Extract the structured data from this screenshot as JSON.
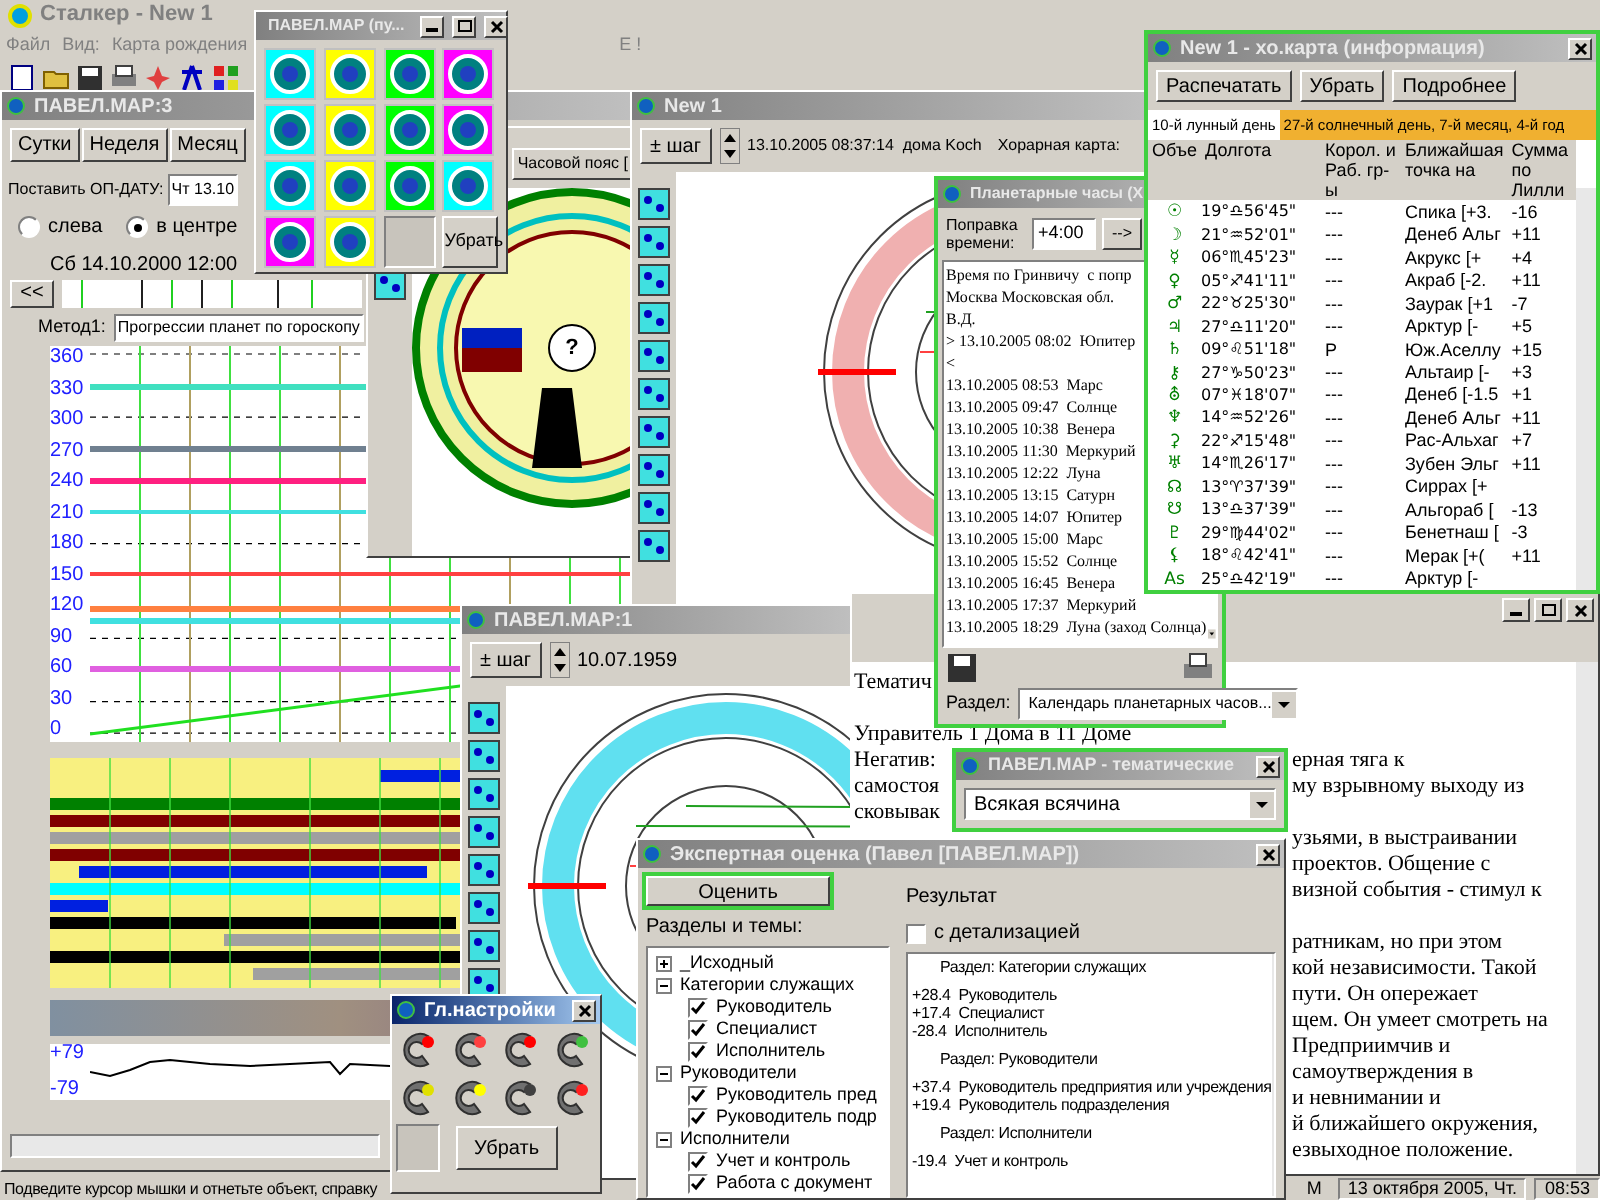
{
  "app": {
    "title": "Сталкер - New 1",
    "menu": [
      "Файл",
      "Вид:",
      "Карта рождения",
      "E !"
    ]
  },
  "tool_palette": {
    "title": "ПАВЕЛ.MAP (пу...",
    "button": "Убрать"
  },
  "schedule_window": {
    "title": "ПАВЕЛ.MAP:3",
    "tabs": [
      {
        "label": "Сутки",
        "selected": false
      },
      {
        "label": "Неделя",
        "selected": false
      },
      {
        "label": "Месяц",
        "selected": false
      }
    ],
    "date_label": "Поставить ОП-ДАТУ:",
    "date_value": "Чт 13.10",
    "align": [
      {
        "label": "слева",
        "selected": false
      },
      {
        "label": "в центре",
        "selected": true
      }
    ],
    "current": "Сб 14.10.2000 12:00",
    "back_button": "<<",
    "method_label": "Метод1:",
    "method_value": "Прогрессии планет по гороскопу",
    "y_labels": [
      "360",
      "330",
      "300",
      "270",
      "240",
      "210",
      "180",
      "150",
      "120",
      "90",
      "60",
      "30",
      "0"
    ],
    "index_labels": [
      "+79",
      "-79"
    ]
  },
  "wheel_window": {
    "timezone_button": "Часовой пояс [",
    "center": "?"
  },
  "horary_window": {
    "title": "New 1",
    "step_button": "± шаг",
    "datetime": "13.10.2005 08:37:14  дома Koch",
    "chart_label": "Хорарная карта:"
  },
  "hours_window": {
    "title": "Планетарные часы (Х",
    "correction_label": "Поправка времени:",
    "correction_value": "+4:00",
    "go_button": "-->",
    "lines": [
      "Время по Гринвичу  с попр",
      "Москва Московская обл.",
      "В.Д.",
      "> 13.10.2005 08:02  Юпитер",
      "<",
      "13.10.2005 08:53  Марс",
      "13.10.2005 09:47  Солнце",
      "13.10.2005 10:38  Венера",
      "13.10.2005 11:30  Меркурий",
      "13.10.2005 12:22  Луна",
      "13.10.2005 13:15  Сатурн",
      "13.10.2005 14:07  Юпитер",
      "13.10.2005 15:00  Марс",
      "13.10.2005 15:52  Солнце",
      "13.10.2005 16:45  Венера",
      "13.10.2005 17:37  Меркурий",
      "13.10.2005 18:29  Луна (заход Солнца)"
    ],
    "section_label": "Раздел:",
    "section_value": "Календарь планетарных часов..."
  },
  "info_window": {
    "title": "New 1 - хо.карта (информация)",
    "buttons": [
      "Распечатать",
      "Убрать",
      "Подробнее"
    ],
    "tabs": [
      {
        "label": "10-й лунный день",
        "selected": true
      },
      {
        "label": "27-й солнечный день, 7-й месяц, 4-й год",
        "selected": false
      }
    ],
    "columns": [
      "Объе",
      "Долгота",
      "Корол. и Раб. гр-ы",
      "Ближайшая точка на",
      "Сумма по Лилли"
    ],
    "rows": [
      {
        "object": "☉",
        "longitude": "19°♎56'45\"",
        "group": "---",
        "point": "Спика [+3.",
        "sum": "-16"
      },
      {
        "object": "☽",
        "longitude": "21°♒52'01\"",
        "group": "---",
        "point": "Денеб Альг",
        "sum": "+11"
      },
      {
        "object": "☿",
        "longitude": "06°♏45'23\"",
        "group": "---",
        "point": "Акрукс [+",
        "sum": "+4"
      },
      {
        "object": "♀",
        "longitude": "05°♐41'11\"",
        "group": "---",
        "point": "Акраб [-2.",
        "sum": "+11"
      },
      {
        "object": "♂",
        "longitude": "22°♉25'30\"",
        "group": "---",
        "point": "Заурак [+1",
        "sum": "-7"
      },
      {
        "object": "♃",
        "longitude": "27°♎11'20\"",
        "group": "---",
        "point": "Арктур [-",
        "sum": "+5"
      },
      {
        "object": "♄",
        "longitude": "09°♌51'18\"",
        "group": "Р",
        "point": "Юж.Аселлу",
        "sum": "+15"
      },
      {
        "object": "⚷",
        "longitude": "27°♑50'23\"",
        "group": "---",
        "point": "Альтаир [-",
        "sum": "+3"
      },
      {
        "object": "⛢",
        "longitude": "07°♓18'07\"",
        "group": "---",
        "point": "Денеб [-1.5",
        "sum": "+1"
      },
      {
        "object": "♆",
        "longitude": "14°♒52'26\"",
        "group": "---",
        "point": "Денеб Альг",
        "sum": "+11"
      },
      {
        "object": "⚳",
        "longitude": "22°♐15'48\"",
        "group": "---",
        "point": "Рас-Альхаг",
        "sum": "+7"
      },
      {
        "object": "♅",
        "longitude": "14°♏26'17\"",
        "group": "---",
        "point": "Зубен Эльг",
        "sum": "+11"
      },
      {
        "object": "☊",
        "longitude": "13°♈37'39\"",
        "group": "---",
        "point": "Сиррах [+"
      },
      {
        "object": "☋",
        "longitude": "13°♎37'39\"",
        "group": "---",
        "point": "Альгораб [",
        "sum": "-13"
      },
      {
        "object": "♇",
        "longitude": "29°♍44'02\"",
        "group": "---",
        "point": "Бенетнаш [",
        "sum": "-3"
      },
      {
        "object": "⚸",
        "longitude": "18°♌42'41\"",
        "group": "---",
        "point": "Мерак [+(",
        "sum": "+11"
      },
      {
        "object": "As",
        "longitude": "25°♎42'19\"",
        "group": "---",
        "point": "Арктур [-"
      }
    ]
  },
  "natal_window": {
    "title": "ПАВЕЛ.MAP:1",
    "step_button": "± шаг",
    "date": "10.07.1959"
  },
  "text_window": {
    "paragraphs": [
      [
        {
          "left": "Тематич"
        }
      ],
      [
        {
          "left": "Управитель 1 Дома в 11 Доме"
        },
        {
          "left": "Негатив:",
          "right": "ерная тяга к"
        },
        {
          "left": "самостоя",
          "right": "му взрывному выходу из"
        },
        {
          "left": "сковывак"
        },
        {
          "right": "узьями, в выстраивании"
        },
        {
          "right": "проектов. Общение с"
        },
        {
          "right": "визной события - стимул к"
        }
      ],
      [
        {
          "right": "ратникам, но при этом"
        },
        {
          "right": "кой независимости. Такой"
        },
        {
          "right": "пути. Он опережает"
        },
        {
          "right": "щем. Он умеет смотреть на"
        },
        {
          "right": "Предприимчив и"
        },
        {
          "right": "самоутверждения в"
        },
        {
          "right": "и невнимании и"
        },
        {
          "right": "й ближайшего окружения,"
        },
        {
          "right": "езвыходное положение."
        }
      ]
    ]
  },
  "themes_window": {
    "title": "ПАВЕЛ.MAP - тематические",
    "value": "Всякая всячина"
  },
  "expert_window": {
    "title": "Экспертная оценка (Павел [ПАВЕЛ.MAP])",
    "evaluate_button": "Оценить",
    "sections_label": "Разделы и темы:",
    "result_label": "Результат",
    "detail": {
      "label": "с детализацией",
      "checked": false
    },
    "tree": [
      {
        "label": "_Исходный",
        "expanded": false
      },
      {
        "label": "Категории служащих",
        "expanded": true,
        "children": [
          {
            "label": "Руководитель",
            "checked": true
          },
          {
            "label": "Специалист",
            "checked": true
          },
          {
            "label": "Исполнитель",
            "checked": true
          }
        ]
      },
      {
        "label": "Руководители",
        "expanded": true,
        "children": [
          {
            "label": "Руководитель пред",
            "checked": true
          },
          {
            "label": "Руководитель подр",
            "checked": true
          }
        ]
      },
      {
        "label": "Исполнители",
        "expanded": true,
        "children": [
          {
            "label": "Учет и контроль",
            "checked": true
          },
          {
            "label": "Работа с документ",
            "checked": true
          }
        ]
      }
    ],
    "results": [
      {
        "kind": "heading",
        "text": "Раздел: Категории служащих"
      },
      {
        "kind": "score",
        "text": "+28.4  Руководитель"
      },
      {
        "kind": "score",
        "text": "+17.4  Специалист"
      },
      {
        "kind": "score",
        "text": "-28.4  Исполнитель"
      },
      {
        "kind": "heading",
        "text": "Раздел: Руководители"
      },
      {
        "kind": "score",
        "text": "+37.4  Руководитель предприятия или учреждения"
      },
      {
        "kind": "score",
        "text": "+19.4  Руководитель подразделения"
      },
      {
        "kind": "heading",
        "text": "Раздел: Исполнители"
      },
      {
        "kind": "score",
        "text": "-19.4  Учет и контроль"
      }
    ]
  },
  "settings_window": {
    "title": "Гл.настройки",
    "button": "Убрать"
  },
  "status_bar": {
    "hint": "Подведите курсор мышки и отнетьте объект, справку",
    "panel": "M",
    "date": "13 октября 2005, Чт.",
    "time": "08:53"
  }
}
